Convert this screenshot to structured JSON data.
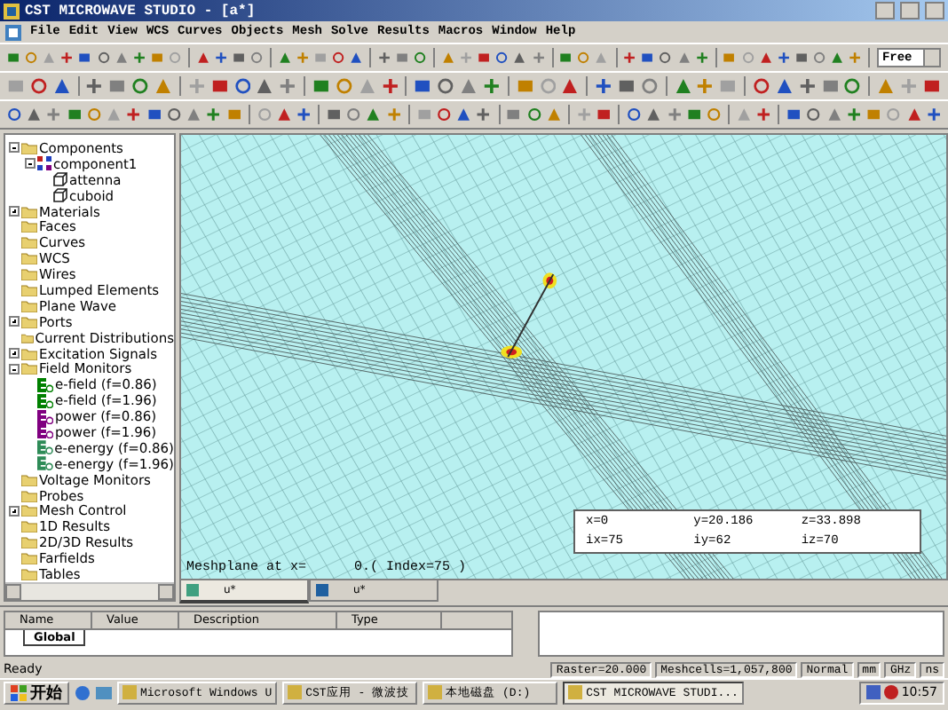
{
  "window": {
    "title": "CST MICROWAVE STUDIO - [a*]"
  },
  "menu": [
    "File",
    "Edit",
    "View",
    "WCS",
    "Curves",
    "Objects",
    "Mesh",
    "Solve",
    "Results",
    "Macros",
    "Window",
    "Help"
  ],
  "toolbar": {
    "mode_dropdown": "Free"
  },
  "tree": [
    {
      "label": "Components",
      "kind": "folder",
      "expanded": true,
      "children": [
        {
          "label": "component1",
          "kind": "component",
          "expanded": true,
          "children": [
            {
              "label": "attenna",
              "kind": "solid"
            },
            {
              "label": "cuboid",
              "kind": "solid"
            }
          ]
        }
      ]
    },
    {
      "label": "Materials",
      "kind": "folder",
      "expanded": false
    },
    {
      "label": "Faces",
      "kind": "folder"
    },
    {
      "label": "Curves",
      "kind": "folder"
    },
    {
      "label": "WCS",
      "kind": "folder"
    },
    {
      "label": "Wires",
      "kind": "folder"
    },
    {
      "label": "Lumped Elements",
      "kind": "folder"
    },
    {
      "label": "Plane Wave",
      "kind": "folder"
    },
    {
      "label": "Ports",
      "kind": "folder",
      "expanded": false
    },
    {
      "label": "Current Distributions",
      "kind": "folder"
    },
    {
      "label": "Excitation Signals",
      "kind": "folder",
      "expanded": false
    },
    {
      "label": "Field Monitors",
      "kind": "folder",
      "expanded": true,
      "children": [
        {
          "label": "e-field (f=0.86)",
          "kind": "monitor",
          "color": "#008000"
        },
        {
          "label": "e-field (f=1.96)",
          "kind": "monitor",
          "color": "#008000"
        },
        {
          "label": "power (f=0.86)",
          "kind": "monitor",
          "color": "#800080"
        },
        {
          "label": "power (f=1.96)",
          "kind": "monitor",
          "color": "#800080"
        },
        {
          "label": "e-energy (f=0.86)",
          "kind": "monitor",
          "color": "#2e8b57"
        },
        {
          "label": "e-energy (f=1.96)",
          "kind": "monitor",
          "color": "#2e8b57"
        }
      ]
    },
    {
      "label": "Voltage Monitors",
      "kind": "folder"
    },
    {
      "label": "Probes",
      "kind": "folder"
    },
    {
      "label": "Mesh Control",
      "kind": "folder",
      "expanded": false
    },
    {
      "label": "1D Results",
      "kind": "folder"
    },
    {
      "label": "2D/3D Results",
      "kind": "folder"
    },
    {
      "label": "Farfields",
      "kind": "folder"
    },
    {
      "label": "Tables",
      "kind": "folder"
    }
  ],
  "view": {
    "coordinates": [
      {
        "label": "x=0"
      },
      {
        "label": "y=20.186"
      },
      {
        "label": "z=33.898"
      },
      {
        "label": "ix=75"
      },
      {
        "label": "iy=62"
      },
      {
        "label": "iz=70"
      }
    ],
    "meshplane": "Meshplane at x=      0.( Index=75 )",
    "tabs": [
      {
        "label": "u*",
        "selected": true
      },
      {
        "label": "u*",
        "selected": false
      }
    ]
  },
  "parameters": {
    "columns": [
      "Name",
      "Value",
      "Description",
      "Type"
    ],
    "tabs": [
      {
        "label": "Global",
        "selected": true
      }
    ]
  },
  "status_bar": {
    "message": "Ready",
    "fields": [
      "Raster=20.000",
      "Meshcells=1,057,800",
      "Normal",
      "mm",
      "GHz",
      "ns"
    ]
  },
  "taskbar": {
    "start": "开始",
    "tasks": [
      {
        "label": "Microsoft Windows U",
        "selected": false
      },
      {
        "label": "CST应用 - 微波技",
        "selected": false
      },
      {
        "label": "本地磁盘 (D:)",
        "selected": false
      },
      {
        "label": "CST MICROWAVE STUDI...",
        "selected": true
      }
    ],
    "clock": "10:57"
  }
}
